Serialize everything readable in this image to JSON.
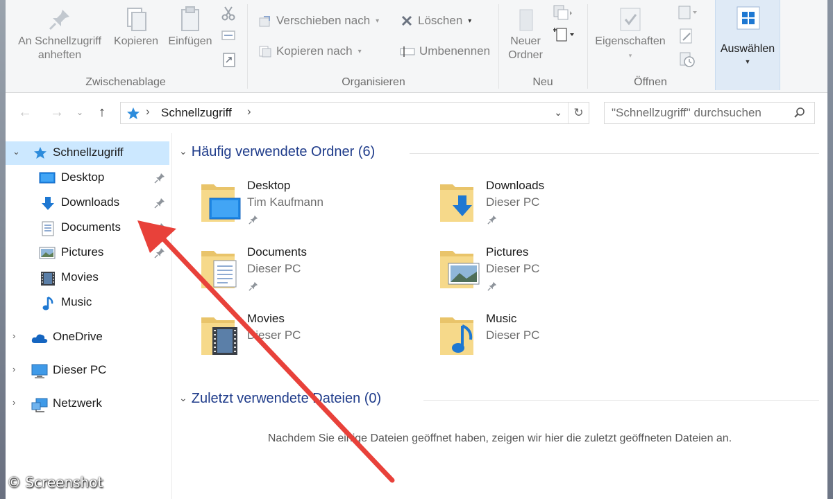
{
  "ribbon": {
    "zwischenablage": {
      "pin_label_line1": "An Schnellzugriff",
      "pin_label_line2": "anheften",
      "copy_label": "Kopieren",
      "paste_label": "Einfügen",
      "group_label": "Zwischenablage"
    },
    "organisieren": {
      "move_label": "Verschieben nach",
      "copy_to_label": "Kopieren nach",
      "delete_label": "Löschen",
      "rename_label": "Umbenennen",
      "group_label": "Organisieren"
    },
    "neu": {
      "new_folder_line1": "Neuer",
      "new_folder_line2": "Ordner",
      "group_label": "Neu"
    },
    "oeffnen": {
      "properties_label": "Eigenschaften",
      "group_label": "Öffnen"
    },
    "auswaehlen": {
      "label": "Auswählen"
    }
  },
  "address": {
    "crumb": "Schnellzugriff",
    "search_placeholder": "\"Schnellzugriff\" durchsuchen"
  },
  "nav": {
    "quick_access": "Schnellzugriff",
    "items": [
      {
        "label": "Desktop"
      },
      {
        "label": "Downloads"
      },
      {
        "label": "Documents"
      },
      {
        "label": "Pictures"
      },
      {
        "label": "Movies"
      },
      {
        "label": "Music"
      }
    ],
    "onedrive": "OneDrive",
    "this_pc": "Dieser PC",
    "network": "Netzwerk"
  },
  "content": {
    "frequent_header": "Häufig verwendete Ordner (6)",
    "folders": [
      {
        "name": "Desktop",
        "location": "Tim Kaufmann"
      },
      {
        "name": "Downloads",
        "location": "Dieser PC"
      },
      {
        "name": "Documents",
        "location": "Dieser PC"
      },
      {
        "name": "Pictures",
        "location": "Dieser PC"
      },
      {
        "name": "Movies",
        "location": "Dieser PC"
      },
      {
        "name": "Music",
        "location": "Dieser PC"
      }
    ],
    "recent_header": "Zuletzt verwendete Dateien (0)",
    "recent_empty": "Nachdem Sie einige Dateien geöffnet haben, zeigen wir hier die zuletzt geöffneten Dateien an."
  },
  "watermark": "© Screenshot",
  "colors": {
    "accent_blue": "#1e3b8a",
    "selection": "#cce8ff",
    "annotation_arrow": "#e8413a"
  }
}
